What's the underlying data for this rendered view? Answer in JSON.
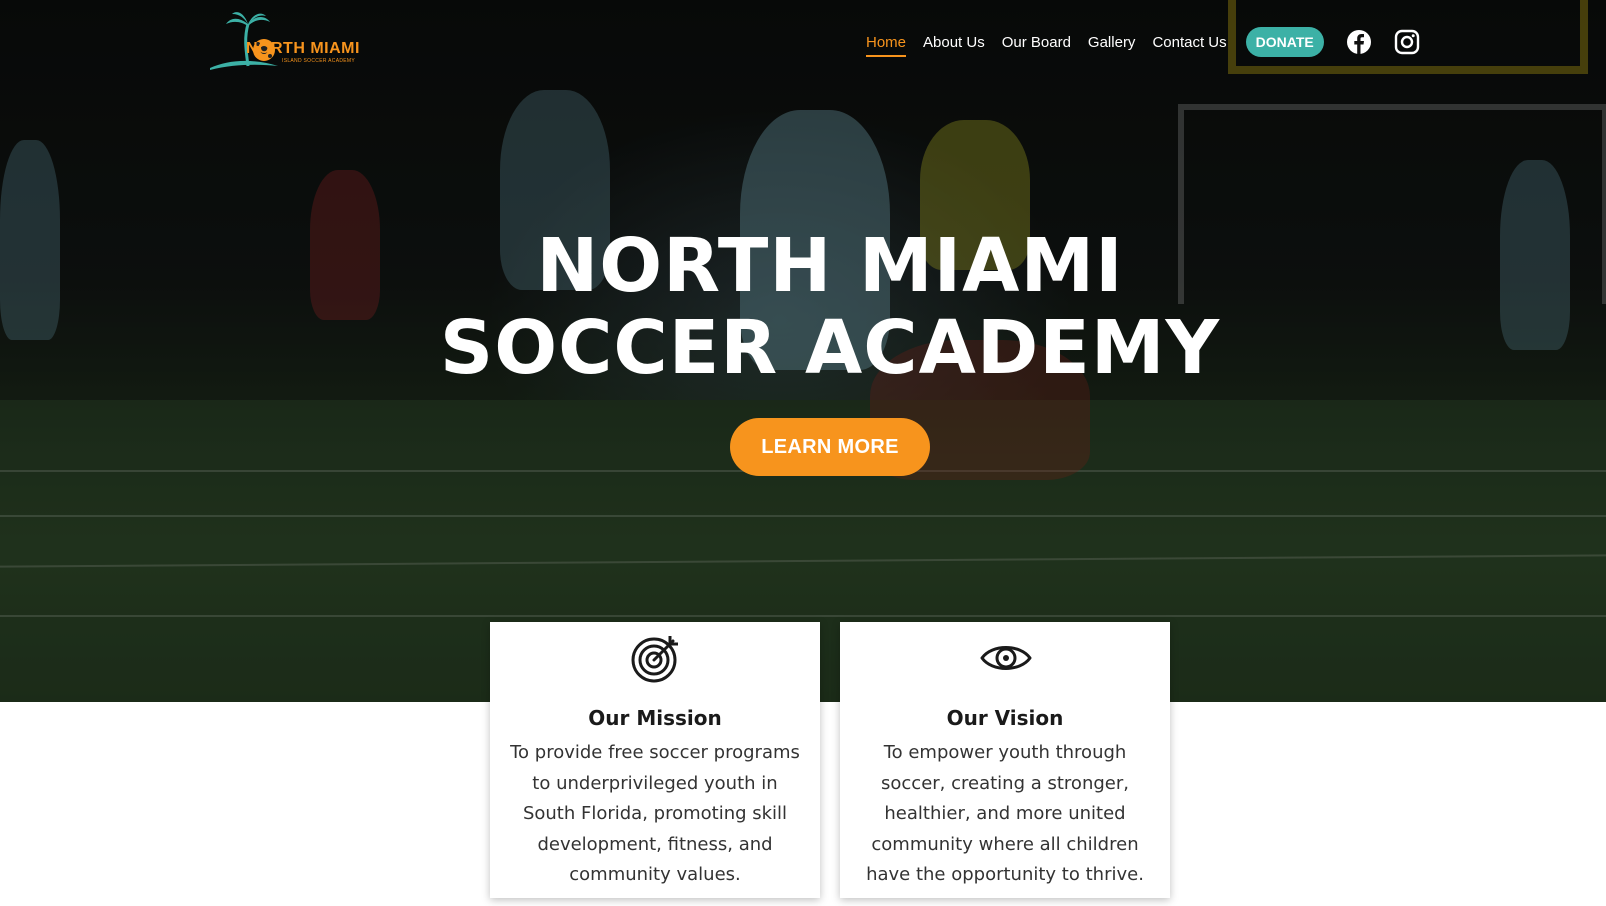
{
  "brand": {
    "logo_name": "NORTH MIAMI",
    "logo_tagline": "ISLAND SOCCER ACADEMY",
    "colors": {
      "accent": "#f7941d",
      "teal": "#3cb1a6",
      "text_dark": "#1a1a1a"
    }
  },
  "nav": {
    "items": [
      {
        "label": "Home",
        "active": true
      },
      {
        "label": "About Us",
        "active": false
      },
      {
        "label": "Our Board",
        "active": false
      },
      {
        "label": "Gallery",
        "active": false
      },
      {
        "label": "Contact Us",
        "active": false
      }
    ],
    "donate_label": "DONATE",
    "social": [
      "facebook-icon",
      "instagram-icon"
    ]
  },
  "hero": {
    "title_line1": "NORTH MIAMI",
    "title_line2": "SOCCER ACADEMY",
    "cta_label": "LEARN MORE"
  },
  "cards": [
    {
      "icon": "target-icon",
      "title": "Our Mission",
      "text": "To provide free soccer programs to underprivileged youth in South Florida, promoting skill development, fitness, and community values."
    },
    {
      "icon": "eye-icon",
      "title": "Our Vision",
      "text": "To empower youth through soccer, creating a stronger, healthier, and more united community where all children have the opportunity to thrive."
    }
  ]
}
